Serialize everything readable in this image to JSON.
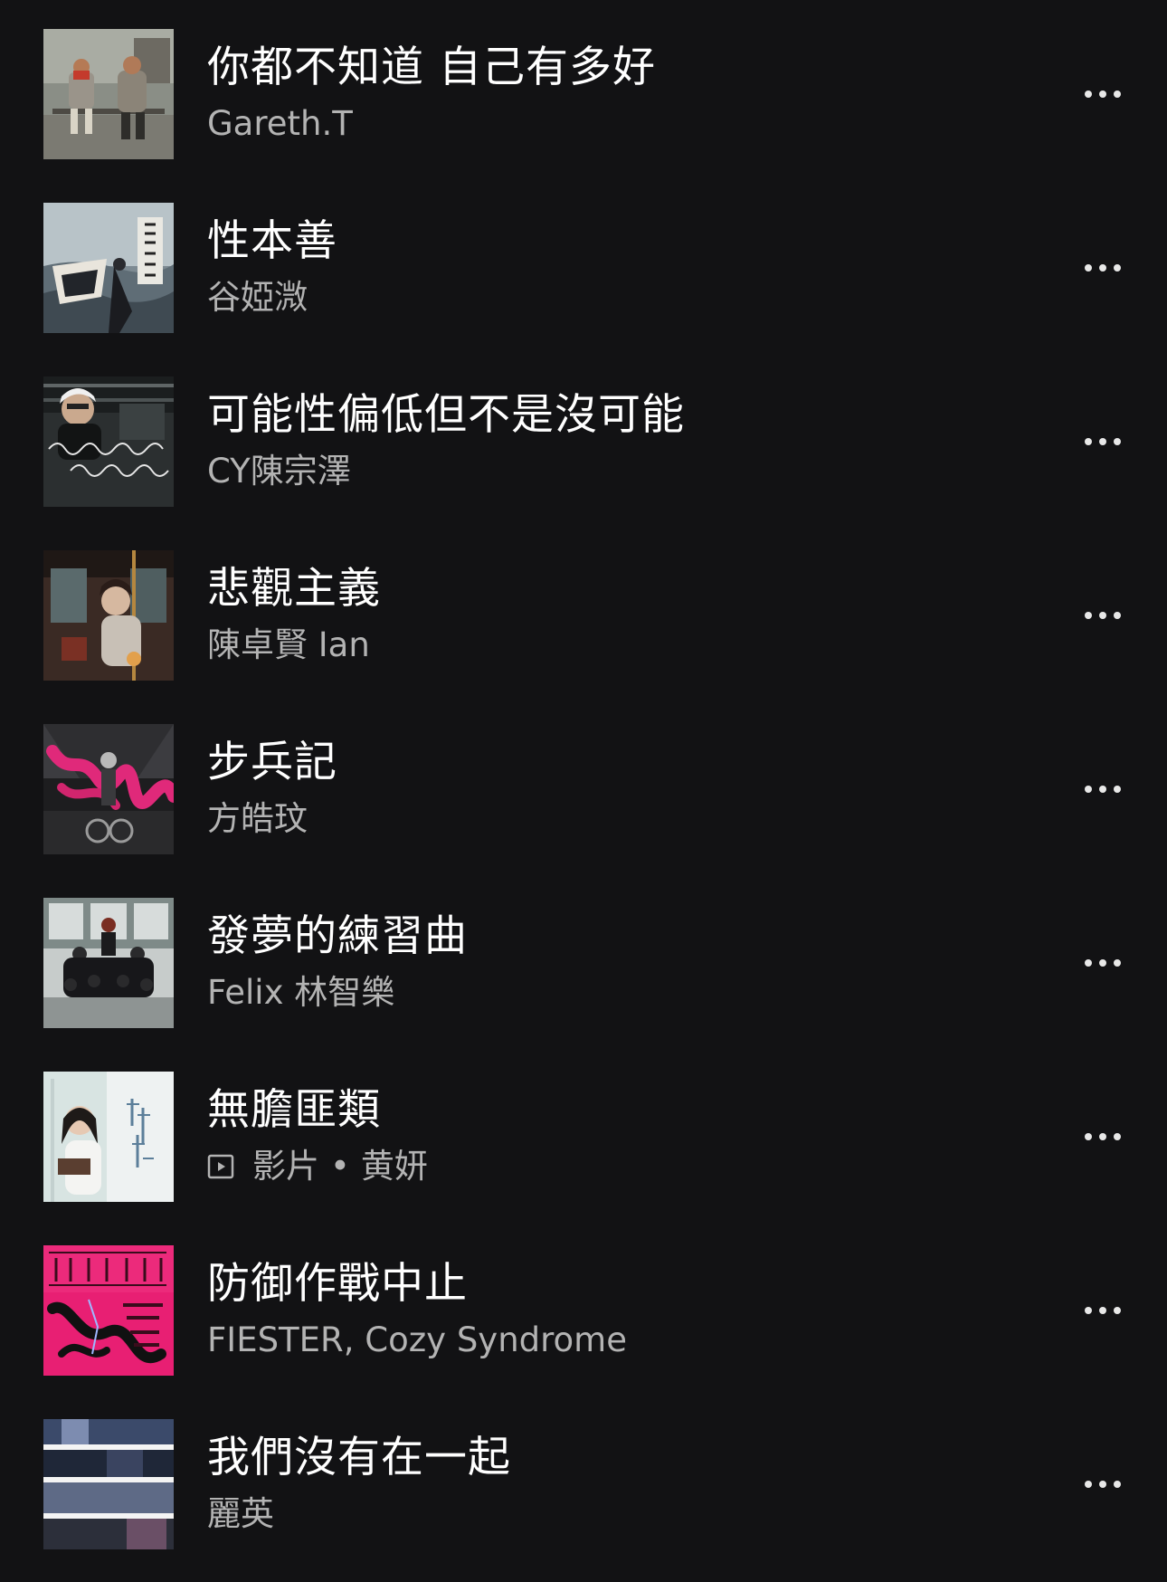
{
  "colors": {
    "background": "#121214",
    "title": "#ffffff",
    "subtitle": "#b3b3b3"
  },
  "tracks": [
    {
      "title": "你都不知道 自己有多好",
      "artist": "Gareth.T",
      "cover_icon": "album-cover-photo-two-people-bench",
      "more_icon": "more-options-icon"
    },
    {
      "title": "性本善",
      "artist": "谷婭溦",
      "cover_icon": "album-cover-sea-boat",
      "more_icon": "more-options-icon"
    },
    {
      "title": "可能性偏低但不是沒可能",
      "artist": "CY陳宗澤",
      "cover_icon": "album-cover-portrait-handwriting",
      "more_icon": "more-options-icon"
    },
    {
      "title": "悲觀主義",
      "artist": "陳卓賢 Ian",
      "cover_icon": "album-cover-train-umbrella",
      "more_icon": "more-options-icon"
    },
    {
      "title": "步兵記",
      "artist": "方皓玟",
      "cover_icon": "album-cover-street-pink-brush",
      "more_icon": "more-options-icon"
    },
    {
      "title": "發夢的練習曲",
      "artist": "Felix 林智樂",
      "cover_icon": "album-cover-group-classroom",
      "more_icon": "more-options-icon"
    },
    {
      "title": "無膽匪類",
      "video_label": "影片",
      "separator": "•",
      "artist": "黄妍",
      "cover_icon": "album-cover-girl-reading",
      "subtitle_icon": "video-icon",
      "more_icon": "more-options-icon"
    },
    {
      "title": "防御作戰中止",
      "artist": "FIESTER, Cozy Syndrome",
      "cover_icon": "album-cover-pink-calligraphy",
      "more_icon": "more-options-icon"
    },
    {
      "title": "我們沒有在一起",
      "artist": "麗英",
      "cover_icon": "album-cover-collage",
      "more_icon": "more-options-icon"
    }
  ]
}
